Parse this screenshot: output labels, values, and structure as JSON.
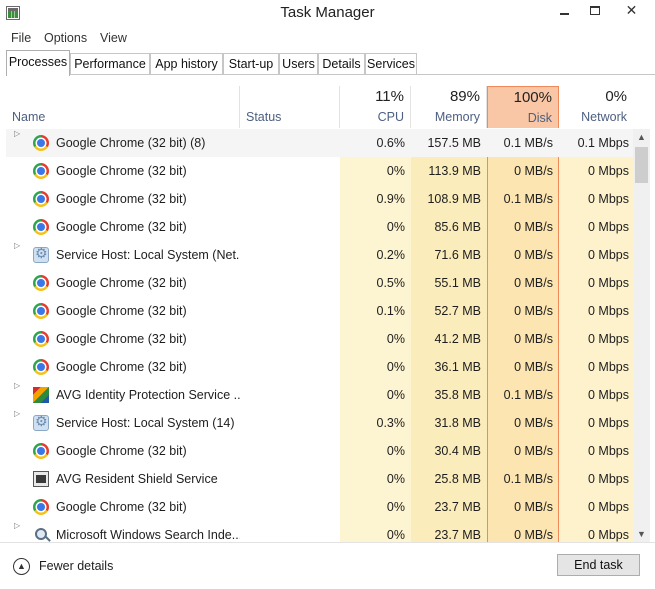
{
  "window": {
    "title": "Task Manager",
    "minimize_icon": "minimize-icon",
    "maximize_icon": "maximize-icon",
    "close_symbol": "✕"
  },
  "menu": [
    "File",
    "Options",
    "View"
  ],
  "tabs": [
    "Processes",
    "Performance",
    "App history",
    "Start-up",
    "Users",
    "Details",
    "Services"
  ],
  "active_tab": "Processes",
  "columns": {
    "name": "Name",
    "status": "Status",
    "cpu": {
      "percent": "11%",
      "label": "CPU"
    },
    "memory": {
      "percent": "89%",
      "label": "Memory"
    },
    "disk": {
      "percent": "100%",
      "label": "Disk"
    },
    "network": {
      "percent": "0%",
      "label": "Network"
    }
  },
  "colors": {
    "disk_header": "#f9c7a5",
    "disk_border": "#f08a5a",
    "cpu_shade": "#fdf4d1",
    "memory_shade": "#fbecbb",
    "disk_shade": "#fce5b0",
    "network_shade": "#fdf2cc"
  },
  "processes": [
    {
      "name": "Google Chrome (32 bit) (8)",
      "icon": "chrome-icon",
      "expandable": true,
      "cpu": "0.6%",
      "memory": "157.5 MB",
      "disk": "0.1 MB/s",
      "network": "0.1 Mbps",
      "selected": true
    },
    {
      "name": "Google Chrome (32 bit)",
      "icon": "chrome-icon",
      "expandable": false,
      "cpu": "0%",
      "memory": "113.9 MB",
      "disk": "0 MB/s",
      "network": "0 Mbps"
    },
    {
      "name": "Google Chrome (32 bit)",
      "icon": "chrome-icon",
      "expandable": false,
      "cpu": "0.9%",
      "memory": "108.9 MB",
      "disk": "0.1 MB/s",
      "network": "0 Mbps"
    },
    {
      "name": "Google Chrome (32 bit)",
      "icon": "chrome-icon",
      "expandable": false,
      "cpu": "0%",
      "memory": "85.6 MB",
      "disk": "0 MB/s",
      "network": "0 Mbps"
    },
    {
      "name": "Service Host: Local System (Net...",
      "icon": "gear-icon",
      "expandable": true,
      "cpu": "0.2%",
      "memory": "71.6 MB",
      "disk": "0 MB/s",
      "network": "0 Mbps"
    },
    {
      "name": "Google Chrome (32 bit)",
      "icon": "chrome-icon",
      "expandable": false,
      "cpu": "0.5%",
      "memory": "55.1 MB",
      "disk": "0 MB/s",
      "network": "0 Mbps"
    },
    {
      "name": "Google Chrome (32 bit)",
      "icon": "chrome-icon",
      "expandable": false,
      "cpu": "0.1%",
      "memory": "52.7 MB",
      "disk": "0 MB/s",
      "network": "0 Mbps"
    },
    {
      "name": "Google Chrome (32 bit)",
      "icon": "chrome-icon",
      "expandable": false,
      "cpu": "0%",
      "memory": "41.2 MB",
      "disk": "0 MB/s",
      "network": "0 Mbps"
    },
    {
      "name": "Google Chrome (32 bit)",
      "icon": "chrome-icon",
      "expandable": false,
      "cpu": "0%",
      "memory": "36.1 MB",
      "disk": "0 MB/s",
      "network": "0 Mbps"
    },
    {
      "name": "AVG Identity Protection Service ...",
      "icon": "avg-icon",
      "expandable": true,
      "cpu": "0%",
      "memory": "35.8 MB",
      "disk": "0.1 MB/s",
      "network": "0 Mbps"
    },
    {
      "name": "Service Host: Local System (14)",
      "icon": "gear-icon",
      "expandable": true,
      "cpu": "0.3%",
      "memory": "31.8 MB",
      "disk": "0 MB/s",
      "network": "0 Mbps"
    },
    {
      "name": "Google Chrome (32 bit)",
      "icon": "chrome-icon",
      "expandable": false,
      "cpu": "0%",
      "memory": "30.4 MB",
      "disk": "0 MB/s",
      "network": "0 Mbps"
    },
    {
      "name": "AVG Resident Shield Service",
      "icon": "shield-icon",
      "expandable": false,
      "cpu": "0%",
      "memory": "25.8 MB",
      "disk": "0.1 MB/s",
      "network": "0 Mbps"
    },
    {
      "name": "Google Chrome (32 bit)",
      "icon": "chrome-icon",
      "expandable": false,
      "cpu": "0%",
      "memory": "23.7 MB",
      "disk": "0 MB/s",
      "network": "0 Mbps"
    },
    {
      "name": "Microsoft Windows Search Inde...",
      "icon": "search-proc-icon",
      "expandable": true,
      "cpu": "0%",
      "memory": "23.7 MB",
      "disk": "0 MB/s",
      "network": "0 Mbps"
    }
  ],
  "footer": {
    "fewer_details": "Fewer details",
    "end_task": "End task"
  }
}
